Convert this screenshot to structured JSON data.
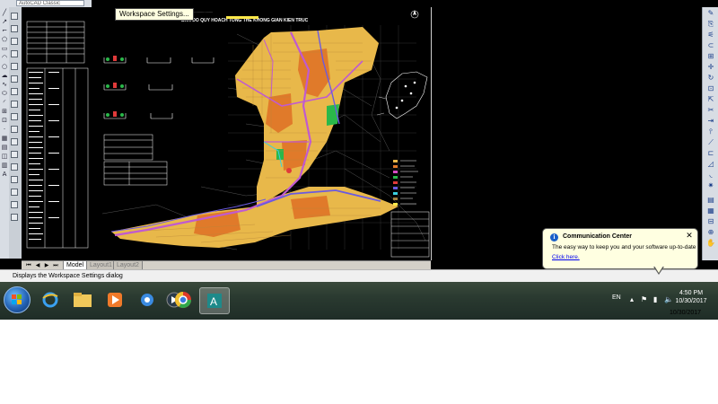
{
  "toolbar": {
    "workspace_value": "AutoCAD Classic"
  },
  "tooltip": {
    "text": "Workspace Settings..."
  },
  "drawing": {
    "title_line1": "BAN DO QUY HOACH TONG THE KHONG GIAN KIEN TRUC",
    "colors": {
      "land_yellow": "#e8b84a",
      "land_orange": "#e07a2a",
      "road_magenta": "#c05ad0",
      "road_blue": "#6a5ae0",
      "green": "#2ab84a",
      "table_white": "#ffffff"
    }
  },
  "layout_tabs": {
    "tabs": [
      "Model",
      "Layout1",
      "Layout2"
    ],
    "active": "Model"
  },
  "status_bar": {
    "text": "Displays the Workspace Settings dialog"
  },
  "communication_center": {
    "title": "Communication Center",
    "message": "The easy way to keep you and your software up-to-date",
    "link": "Click here."
  },
  "taskbar": {
    "language": "EN",
    "time": "4:50 PM",
    "date": "10/30/2017",
    "date_below": "10/30/2017",
    "apps": [
      "start-button",
      "ie-icon",
      "explorer-icon",
      "media-player-icon",
      "messenger-icon",
      "media-player-icon",
      "chrome-icon",
      "autocad-icon"
    ]
  }
}
